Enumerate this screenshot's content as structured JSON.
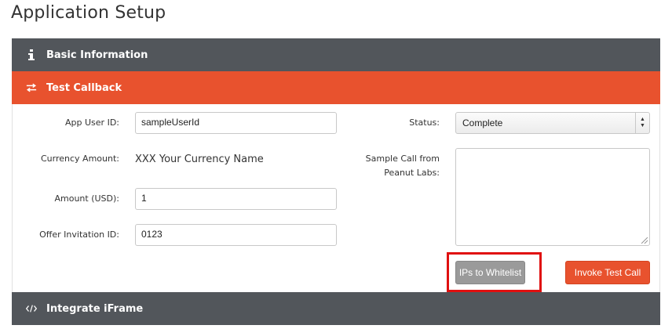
{
  "page": {
    "title": "Application Setup"
  },
  "sections": {
    "basic": {
      "label": "Basic Information",
      "icon": "info-icon"
    },
    "callback": {
      "label": "Test Callback",
      "icon": "swap-arrows-icon"
    },
    "iframe": {
      "label": "Integrate iFrame",
      "icon": "code-icon"
    }
  },
  "form": {
    "app_user_id": {
      "label": "App User ID:",
      "value": "sampleUserId"
    },
    "currency_amount": {
      "label": "Currency Amount:",
      "value": "XXX Your Currency Name"
    },
    "amount_usd": {
      "label": "Amount (USD):",
      "value": "1"
    },
    "offer_invitation_id": {
      "label": "Offer Invitation ID:",
      "value": "0123"
    },
    "status": {
      "label": "Status:",
      "selected": "Complete"
    },
    "sample_call": {
      "label_line1": "Sample Call from",
      "label_line2": "Peanut Labs:",
      "value": ""
    }
  },
  "buttons": {
    "ips_whitelist": "IPs to Whitelist",
    "invoke_test_call": "Invoke Test Call"
  },
  "colors": {
    "accent": "#e8522e",
    "dark_bar": "#52565b",
    "highlight": "#e01010"
  }
}
